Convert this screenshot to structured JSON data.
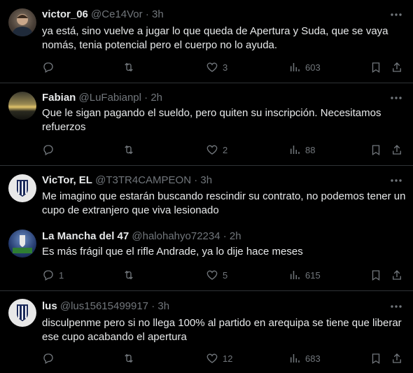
{
  "colors": {
    "background": "#000000",
    "text": "#e7e9ea",
    "muted": "#71767b",
    "divider": "#2f3336"
  },
  "replies": [
    {
      "name": "victor_06",
      "handle": "@Ce14Vor",
      "time": "3h",
      "text": "ya está, sino vuelve a jugar lo que queda de Apertura y Suda, que se vaya nomás, tenia potencial pero el cuerpo no lo ayuda.",
      "reply_count": "",
      "like_count": "3",
      "view_count": "603",
      "avatar": "portrait-avatar"
    },
    {
      "name": "Fabian",
      "handle": "@LuFabianpl",
      "time": "2h",
      "text": "Que le sigan pagando el sueldo, pero quiten su inscripción. Necesitamos refuerzos",
      "reply_count": "",
      "like_count": "2",
      "view_count": "88",
      "avatar": "sunset-avatar"
    },
    {
      "name": "VicTor, EL",
      "handle": "@T3TR4CAMPEON",
      "time": "3h",
      "text": "Me imagino que estarán buscando rescindir su contrato, no podemos tener un cupo de extranjero que viva lesionado",
      "reply_count": "",
      "like_count": "",
      "view_count": "",
      "avatar": "club-crest-avatar"
    },
    {
      "name": "La Mancha del 47",
      "handle": "@halohahyo72234",
      "time": "2h",
      "text": "Es más frágil que el rifle Andrade, ya lo dije hace meses",
      "reply_count": "1",
      "like_count": "5",
      "view_count": "615",
      "avatar": "stadium-avatar"
    },
    {
      "name": "lus",
      "handle": "@lus15615499917",
      "time": "3h",
      "text": "disculpenme pero si no llega 100% al partido en arequipa se tiene que liberar ese cupo acabando el apertura",
      "reply_count": "",
      "like_count": "12",
      "view_count": "683",
      "avatar": "club-crest-avatar"
    }
  ]
}
